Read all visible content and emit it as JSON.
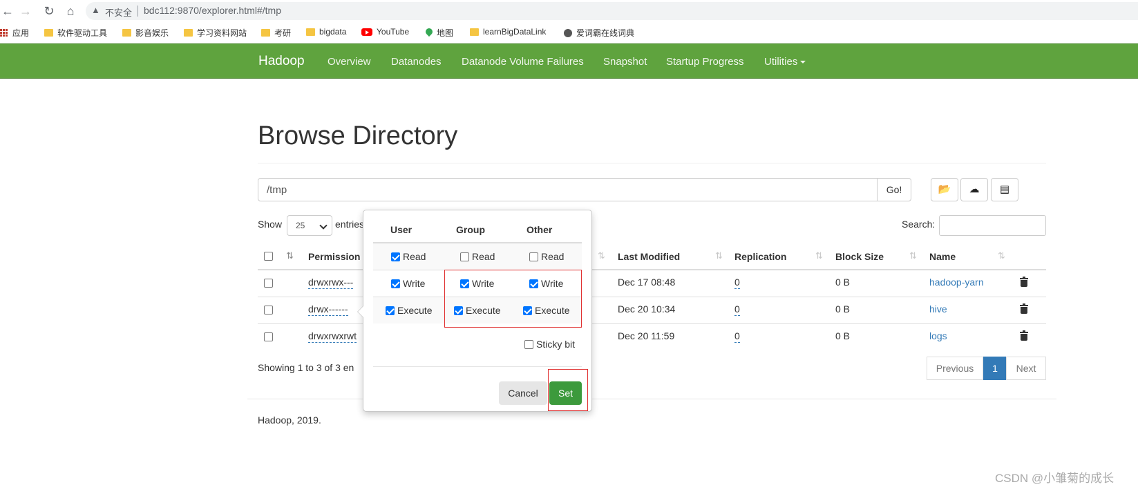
{
  "browser": {
    "insecure_label": "不安全",
    "url": "bdc112:9870/explorer.html#/tmp",
    "bookmarks": [
      {
        "label": "应用",
        "icon": "apps-icon"
      },
      {
        "label": "软件驱动工具",
        "icon": "folder-icon"
      },
      {
        "label": "影音娱乐",
        "icon": "folder-icon"
      },
      {
        "label": "学习资料网站",
        "icon": "folder-icon"
      },
      {
        "label": "考研",
        "icon": "folder-icon"
      },
      {
        "label": "bigdata",
        "icon": "folder-icon"
      },
      {
        "label": "YouTube",
        "icon": "youtube-icon"
      },
      {
        "label": "地图",
        "icon": "maps-icon"
      },
      {
        "label": "learnBigDataLink",
        "icon": "folder-icon"
      },
      {
        "label": "爱词霸在线词典",
        "icon": "globe-icon"
      }
    ]
  },
  "navbar": {
    "brand": "Hadoop",
    "items": [
      "Overview",
      "Datanodes",
      "Datanode Volume Failures",
      "Snapshot",
      "Startup Progress",
      "Utilities"
    ],
    "color": "#5fa33e"
  },
  "page": {
    "title": "Browse Directory",
    "path_value": "/tmp",
    "go_label": "Go!",
    "show_label": "Show",
    "entries_value": "25",
    "entries_label": "entries",
    "search_label": "Search:",
    "columns": [
      "Permission",
      "Last Modified",
      "Replication",
      "Block Size",
      "Name"
    ],
    "rows": [
      {
        "permission": "drwxrwx---",
        "modified": "Dec 17 08:48",
        "replication": "0",
        "block_size": "0 B",
        "name": "hadoop-yarn"
      },
      {
        "permission": "drwx------",
        "modified": "Dec 20 10:34",
        "replication": "0",
        "block_size": "0 B",
        "name": "hive"
      },
      {
        "permission": "drwxrwxrwt",
        "modified": "Dec 20 11:59",
        "replication": "0",
        "block_size": "0 B",
        "name": "logs"
      }
    ],
    "showing_text": "Showing 1 to 3 of 3 en",
    "pagination": {
      "previous": "Previous",
      "current": "1",
      "next": "Next"
    },
    "footer": "Hadoop, 2019."
  },
  "popover": {
    "headers": [
      "User",
      "Group",
      "Other"
    ],
    "read_label": "Read",
    "write_label": "Write",
    "execute_label": "Execute",
    "sticky_label": "Sticky bit",
    "cancel_label": "Cancel",
    "set_label": "Set",
    "checked": {
      "user": {
        "read": true,
        "write": true,
        "execute": true
      },
      "group": {
        "read": false,
        "write": true,
        "execute": true
      },
      "other": {
        "read": false,
        "write": true,
        "execute": true
      },
      "sticky": false
    },
    "set_color": "#3c9a3c"
  },
  "watermark": "CSDN @小雏菊的成长"
}
